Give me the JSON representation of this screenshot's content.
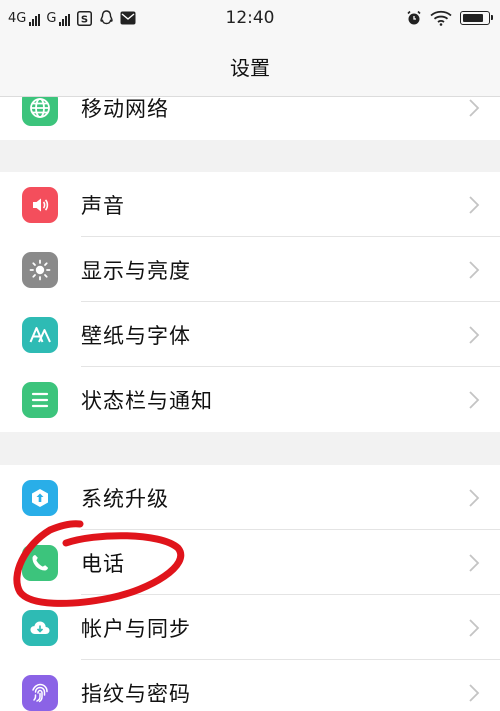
{
  "status_bar": {
    "net1": "4G",
    "net2": "G",
    "time": "12:40",
    "icons": [
      "sim-s-icon",
      "qq-icon",
      "mail-icon",
      "alarm-icon",
      "wifi-icon",
      "battery-icon"
    ],
    "battery_level": 0.85
  },
  "header": {
    "title": "设置"
  },
  "groups": [
    {
      "items": [
        {
          "label": "移动网络",
          "icon": "globe-icon",
          "color": "#3cc47c"
        }
      ]
    },
    {
      "items": [
        {
          "label": "声音",
          "icon": "speaker-icon",
          "color": "#f44e5c"
        },
        {
          "label": "显示与亮度",
          "icon": "brightness-icon",
          "color": "#8a8a8a"
        },
        {
          "label": "壁纸与字体",
          "icon": "wallpaper-font-icon",
          "color": "#2ebbb4"
        },
        {
          "label": "状态栏与通知",
          "icon": "notification-icon",
          "color": "#3cc47c"
        }
      ]
    },
    {
      "items": [
        {
          "label": "系统升级",
          "icon": "system-update-icon",
          "color": "#29aee8"
        },
        {
          "label": "电话",
          "icon": "phone-icon",
          "color": "#3cc47c"
        },
        {
          "label": "帐户与同步",
          "icon": "cloud-sync-icon",
          "color": "#2ebbb4"
        },
        {
          "label": "指纹与密码",
          "icon": "fingerprint-icon",
          "color": "#8b63e6"
        }
      ]
    }
  ],
  "annotation": {
    "color": "#e0141b"
  }
}
